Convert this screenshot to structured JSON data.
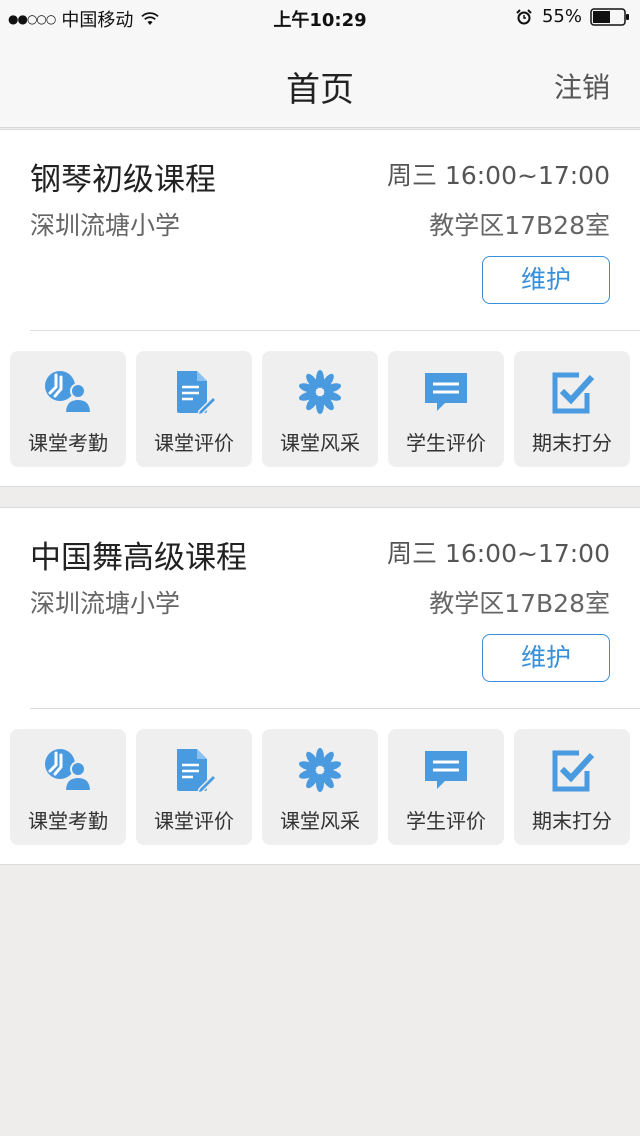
{
  "status_bar": {
    "signal": "●●○○○",
    "carrier": "中国移动",
    "time": "上午10:29",
    "battery": "55%"
  },
  "nav": {
    "title": "首页",
    "logout_label": "注销"
  },
  "courses": [
    {
      "name": "钢琴初级课程",
      "time": "周三 16:00~17:00",
      "school": "深圳流塘小学",
      "room": "教学区17B28室",
      "maintain_label": "维护",
      "actions": [
        {
          "label": "课堂考勤",
          "icon": "attendance-icon"
        },
        {
          "label": "课堂评价",
          "icon": "evaluation-doc-icon"
        },
        {
          "label": "课堂风采",
          "icon": "flower-icon"
        },
        {
          "label": "学生评价",
          "icon": "chat-icon"
        },
        {
          "label": "期末打分",
          "icon": "checkbox-icon"
        }
      ]
    },
    {
      "name": "中国舞高级课程",
      "time": "周三 16:00~17:00",
      "school": "深圳流塘小学",
      "room": "教学区17B28室",
      "maintain_label": "维护",
      "actions": [
        {
          "label": "课堂考勤",
          "icon": "attendance-icon"
        },
        {
          "label": "课堂评价",
          "icon": "evaluation-doc-icon"
        },
        {
          "label": "课堂风采",
          "icon": "flower-icon"
        },
        {
          "label": "学生评价",
          "icon": "chat-icon"
        },
        {
          "label": "期末打分",
          "icon": "checkbox-icon"
        }
      ]
    }
  ],
  "colors": {
    "accent": "#3a8fd9",
    "icon_blue": "#4a9ae0",
    "background": "#eeedeb"
  }
}
